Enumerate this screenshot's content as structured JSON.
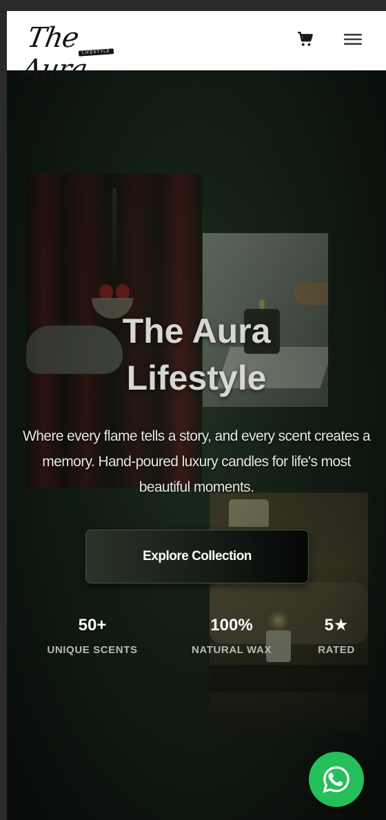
{
  "header": {
    "logo_text": "The Aura",
    "logo_tagline": "Lifestyle"
  },
  "hero": {
    "title_line1": "The Aura",
    "title_line2": "Lifestyle",
    "subtitle": "Where every flame tells a story, and every scent creates a memory. Hand-poured luxury candles for life's most beautiful moments.",
    "cta_label": "Explore Collection"
  },
  "stats": [
    {
      "value": "50+",
      "label": "Unique Scents"
    },
    {
      "value": "100%",
      "label": "Natural Wax"
    },
    {
      "value": "5★",
      "label": "Rated"
    }
  ],
  "icons": {
    "cart": "cart-icon",
    "menu": "hamburger-menu-icon",
    "whatsapp": "whatsapp-icon"
  },
  "colors": {
    "header_bg": "#ffffff",
    "hero_bg": "#142017",
    "whatsapp_green": "#25c05a",
    "text_light": "#d6d6d2"
  }
}
